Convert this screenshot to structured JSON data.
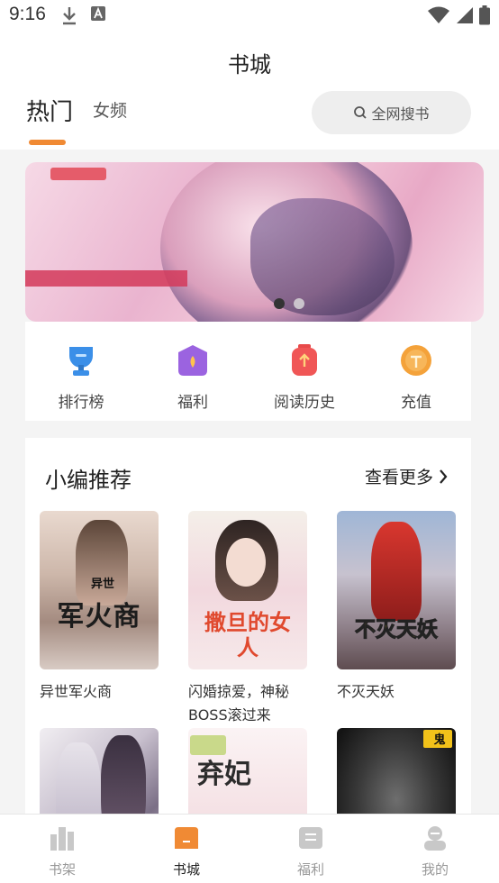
{
  "status": {
    "time": "9:16"
  },
  "header": {
    "title": "书城",
    "tabs": [
      {
        "label": "热门",
        "active": true
      },
      {
        "label": "女频",
        "active": false
      }
    ],
    "search_label": "全网搜书"
  },
  "banner": {
    "slide_count": 2,
    "active_slide": 1
  },
  "quick_links": [
    {
      "label": "排行榜",
      "icon": "trophy-icon"
    },
    {
      "label": "福利",
      "icon": "gift-icon"
    },
    {
      "label": "阅读历史",
      "icon": "history-icon"
    },
    {
      "label": "充值",
      "icon": "coin-icon"
    }
  ],
  "recommend": {
    "title": "小编推荐",
    "more_label": "查看更多",
    "books": [
      {
        "title": "异世军火商",
        "cover_text": "军火商",
        "cover_sub": "异世"
      },
      {
        "title": "闪婚掠爱，神秘BOSS滚过来",
        "cover_text": "撒旦的女人",
        "cover_sub": ""
      },
      {
        "title": "不灭天妖",
        "cover_text": "不灭天妖",
        "cover_sub": ""
      },
      {
        "title": "",
        "cover_text": "",
        "cover_sub": ""
      },
      {
        "title": "",
        "cover_text": "弃妃",
        "cover_sub": ""
      },
      {
        "title": "",
        "cover_text": "",
        "cover_sub": "鬼"
      }
    ]
  },
  "bottom_nav": [
    {
      "label": "书架",
      "active": false
    },
    {
      "label": "书城",
      "active": true
    },
    {
      "label": "福利",
      "active": false
    },
    {
      "label": "我的",
      "active": false
    }
  ],
  "colors": {
    "accent": "#f08a34",
    "nav_inactive": "#999999"
  }
}
